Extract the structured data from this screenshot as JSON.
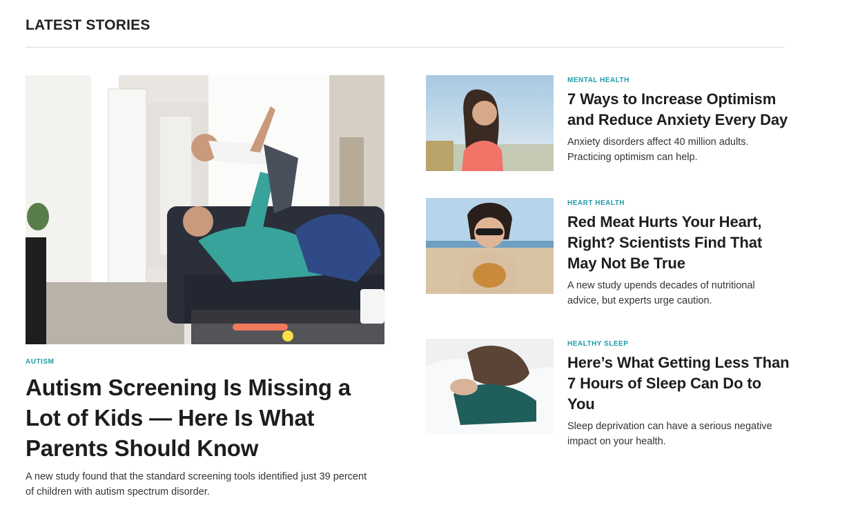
{
  "section": {
    "title": "LATEST STORIES"
  },
  "feature": {
    "category": "AUTISM",
    "headline": "Autism Screening Is Missing a Lot of Kids — Here Is What Parents Should Know",
    "dek": "A new study found that the standard screening tools identified just 39 percent of children with autism spectrum disorder."
  },
  "stories": [
    {
      "category": "MENTAL HEALTH",
      "headline": "7 Ways to Increase Optimism and Reduce Anxiety Every Day",
      "dek": "Anxiety disorders affect 40 million adults. Practicing optimism can help."
    },
    {
      "category": "HEART HEALTH",
      "headline": "Red Meat Hurts Your Heart, Right? Scientists Find That May Not Be True",
      "dek": "A new study upends decades of nutritional advice, but experts urge caution."
    },
    {
      "category": "HEALTHY SLEEP",
      "headline": "Here’s What Getting Less Than 7 Hours of Sleep Can Do to You",
      "dek": "Sleep deprivation can have a serious negative impact on your health."
    }
  ],
  "colors": {
    "category": "#1c9aa8",
    "text": "#1d1d1d",
    "divider": "#d9d9d9"
  }
}
